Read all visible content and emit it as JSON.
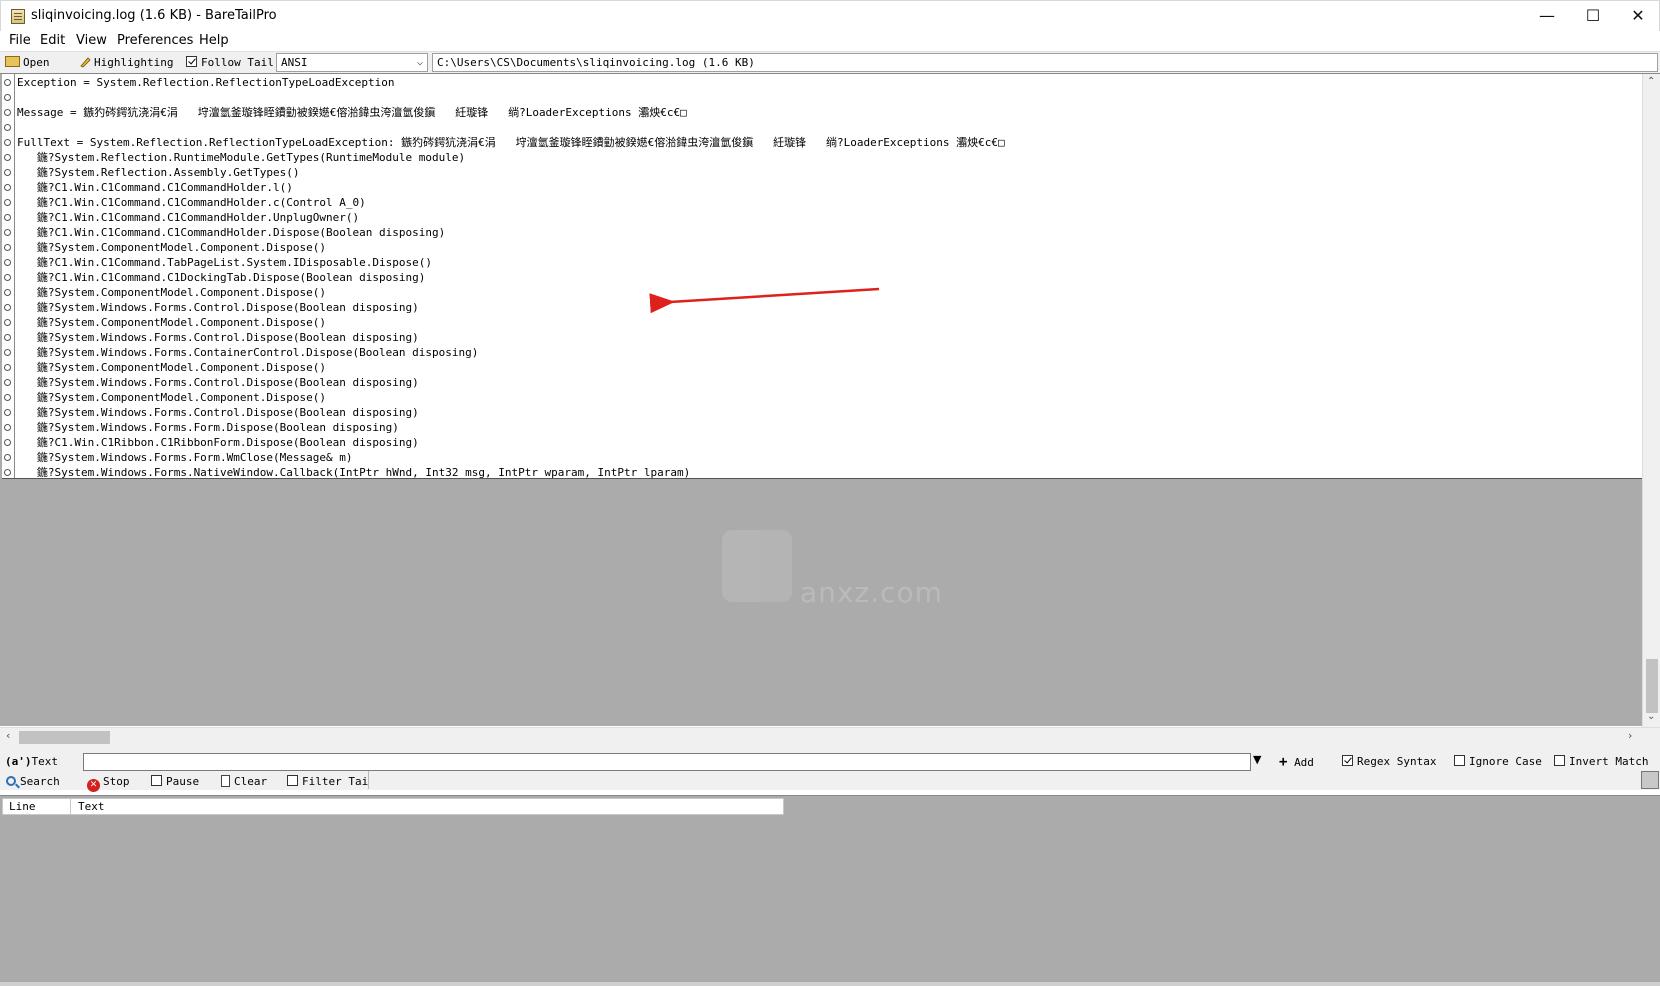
{
  "window": {
    "title": "sliqinvoicing.log (1.6 KB) - BareTailPro",
    "minimize": "—",
    "maximize": "☐",
    "close": "✕"
  },
  "menu": [
    "File",
    "Edit",
    "View",
    "Preferences",
    "Help"
  ],
  "toolbar": {
    "open_label": "Open",
    "highlighting_label": "Highlighting",
    "follow_tail_label": "Follow Tail",
    "follow_tail_checked": true,
    "encoding_value": "ANSI",
    "file_path": "C:\\Users\\CS\\Documents\\sliqinvoicing.log (1.6 KB)"
  },
  "log": {
    "lines": [
      "Exception = System.Reflection.ReflectionTypeLoadException",
      "",
      "Message = 鏃犳硶鍔犺浇涓€涓   垨澶氫釜璇锋眰鐨勭被鍨嬨€傛湁鍏虫洿澶氫俊鎭   紝璇锋   绱?LoaderExceptions 灞炴€с€□",
      "",
      "FullText = System.Reflection.ReflectionTypeLoadException: 鏃犳硶鍔犺浇涓€涓   垨澶氫釜璇锋眰鐨勭被鍨嬨€傛湁鍏虫洿澶氫俊鎭   紝璇锋   绱?LoaderExceptions 灞炴€с€□",
      "   鍦?System.Reflection.RuntimeModule.GetTypes(RuntimeModule module)",
      "   鍦?System.Reflection.Assembly.GetTypes()",
      "   鍦?C1.Win.C1Command.C1CommandHolder.l()",
      "   鍦?C1.Win.C1Command.C1CommandHolder.c(Control A_0)",
      "   鍦?C1.Win.C1Command.C1CommandHolder.UnplugOwner()",
      "   鍦?C1.Win.C1Command.C1CommandHolder.Dispose(Boolean disposing)",
      "   鍦?System.ComponentModel.Component.Dispose()",
      "   鍦?C1.Win.C1Command.TabPageList.System.IDisposable.Dispose()",
      "   鍦?C1.Win.C1Command.C1DockingTab.Dispose(Boolean disposing)",
      "   鍦?System.ComponentModel.Component.Dispose()",
      "   鍦?System.Windows.Forms.Control.Dispose(Boolean disposing)",
      "   鍦?System.ComponentModel.Component.Dispose()",
      "   鍦?System.Windows.Forms.Control.Dispose(Boolean disposing)",
      "   鍦?System.Windows.Forms.ContainerControl.Dispose(Boolean disposing)",
      "   鍦?System.ComponentModel.Component.Dispose()",
      "   鍦?System.Windows.Forms.Control.Dispose(Boolean disposing)",
      "   鍦?System.ComponentModel.Component.Dispose()",
      "   鍦?System.Windows.Forms.Control.Dispose(Boolean disposing)",
      "   鍦?System.Windows.Forms.Form.Dispose(Boolean disposing)",
      "   鍦?C1.Win.C1Ribbon.C1RibbonForm.Dispose(Boolean disposing)",
      "   鍦?System.Windows.Forms.Form.WmClose(Message& m)",
      "   鍦?System.Windows.Forms.NativeWindow.Callback(IntPtr hWnd, Int32 msg, IntPtr wparam, IntPtr lparam)"
    ],
    "annotation_color": "#e0201c"
  },
  "watermark": {
    "text": "anxz.com"
  },
  "search": {
    "text_label": "Text",
    "text_prefix": "(a')",
    "text_value": "",
    "add_label": "Add",
    "regex_label": "Regex Syntax",
    "regex_checked": true,
    "ignore_case_label": "Ignore Case",
    "ignore_case_checked": false,
    "invert_match_label": "Invert Match",
    "invert_match_checked": false,
    "search_label": "Search",
    "stop_label": "Stop",
    "pause_label": "Pause",
    "clear_label": "Clear",
    "filter_tail_label": "Filter Tail"
  },
  "results": {
    "columns": [
      "Line",
      "Text"
    ]
  }
}
